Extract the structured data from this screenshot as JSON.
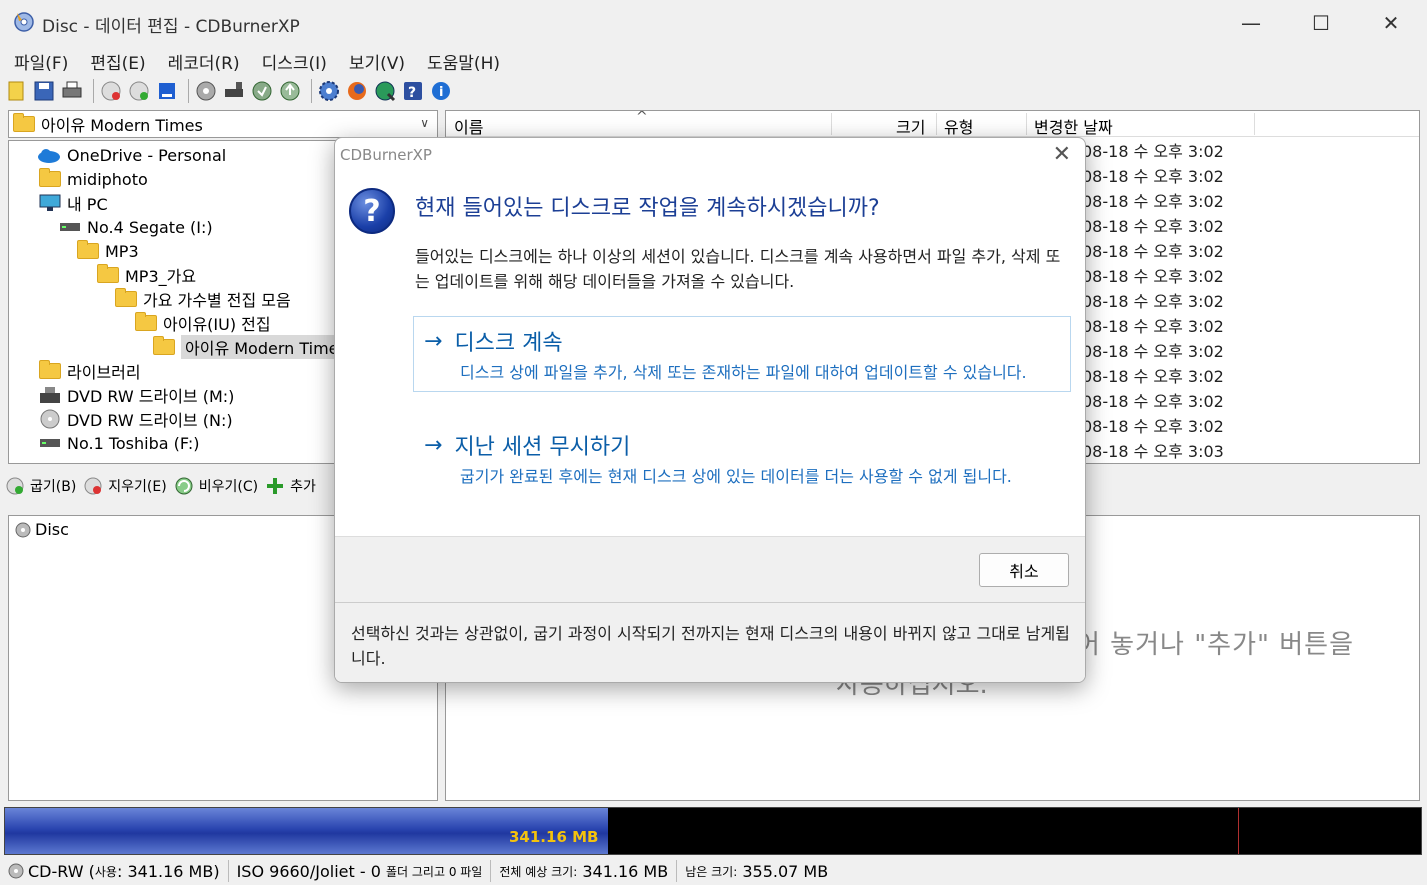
{
  "window": {
    "title": "Disc - 데이터 편집 - CDBurnerXP",
    "minimize_glyph": "—",
    "maximize_glyph": "☐",
    "close_glyph": "✕"
  },
  "menu": [
    "파일(F)",
    "편집(E)",
    "레코더(R)",
    "디스크(I)",
    "보기(V)",
    "도움말(H)"
  ],
  "toolbar_icons": [
    "new-icon",
    "save-icon",
    "print-icon",
    "burn-erase-icon",
    "burn-check-icon",
    "disc-info-icon",
    "disc-copy-icon",
    "drive-icon",
    "refresh-icon",
    "update-icon",
    "settings-icon",
    "firefox-icon",
    "globe-icon",
    "help-icon",
    "info-icon"
  ],
  "drive_combo": {
    "value": "아이유 Modern Times"
  },
  "tree": [
    "OneDrive - Personal",
    "midiphoto",
    "내 PC",
    "No.4 Segate (I:)",
    "MP3",
    "MP3_가요",
    "가요 가수별 전집 모음",
    "아이유(IU) 전집",
    "아이유 Modern Times",
    "라이브러리",
    "DVD RW 드라이브 (M:)",
    "DVD RW 드라이브 (N:)",
    "No.1 Toshiba (F:)"
  ],
  "filelist": {
    "columns": [
      "이름",
      "크기",
      "유형",
      "변경한 날짜"
    ],
    "sort_glyph": "^",
    "dates": [
      "08-18 수 오후 3:02",
      "08-18 수 오후 3:02",
      "08-18 수 오후 3:02",
      "08-18 수 오후 3:02",
      "08-18 수 오후 3:02",
      "08-18 수 오후 3:02",
      "08-18 수 오후 3:02",
      "08-18 수 오후 3:02",
      "08-18 수 오후 3:02",
      "08-18 수 오후 3:02",
      "08-18 수 오후 3:02",
      "08-18 수 오후 3:02",
      "08-18 수 오후 3:03"
    ]
  },
  "actions": {
    "burn": "굽기(B)",
    "erase": "지우기(E)",
    "clear": "비우기(C)",
    "add": "추가"
  },
  "disc_tree": {
    "root": "Disc"
  },
  "disc_content": {
    "hint_line1": "어 놓거나 \"추가\" 버튼을",
    "hint_line2": "사용하십시오."
  },
  "capacity": {
    "label": "341.16 MB",
    "fill_fraction": 0.426,
    "marker_fraction": 0.871
  },
  "status": {
    "disc_type": "CD-RW",
    "used_label": "사용",
    "used_value": "341.16 MB",
    "filesystem": "ISO 9660/Joliet - 0",
    "folders_files": "폴더 그리고 0 파일",
    "total_label": "전체 예상 크기:",
    "total_value": "341.16 MB",
    "remaining_label": "남은 크기:",
    "remaining_value": "355.07 MB"
  },
  "dialog": {
    "title": "CDBurnerXP",
    "close_glyph": "✕",
    "icon_glyph": "?",
    "heading": "현재 들어있는 디스크로 작업을 계속하시겠습니까?",
    "description": "들어있는 디스크에는 하나 이상의 세션이 있습니다. 디스크를 계속 사용하면서 파일 추가, 삭제 또는 업데이트를 위해 해당 데이터들을 가져올 수 있습니다.",
    "option1_title": "디스크 계속",
    "option1_desc": "디스크 상에 파일을 추가, 삭제 또는 존재하는 파일에 대하여 업데이트할 수 있습니다.",
    "option2_title": "지난 세션 무시하기",
    "option2_desc": "굽기가 완료된 후에는 현재 디스크 상에 있는 데이터를 더는 사용할 수 없게 됩니다.",
    "arrow_glyph": "→",
    "cancel": "취소",
    "footer_note": "선택하신 것과는 상관없이, 굽기 과정이 시작되기 전까지는 현재 디스크의 내용이 바뀌지 않고 그대로 남게됩니다."
  }
}
